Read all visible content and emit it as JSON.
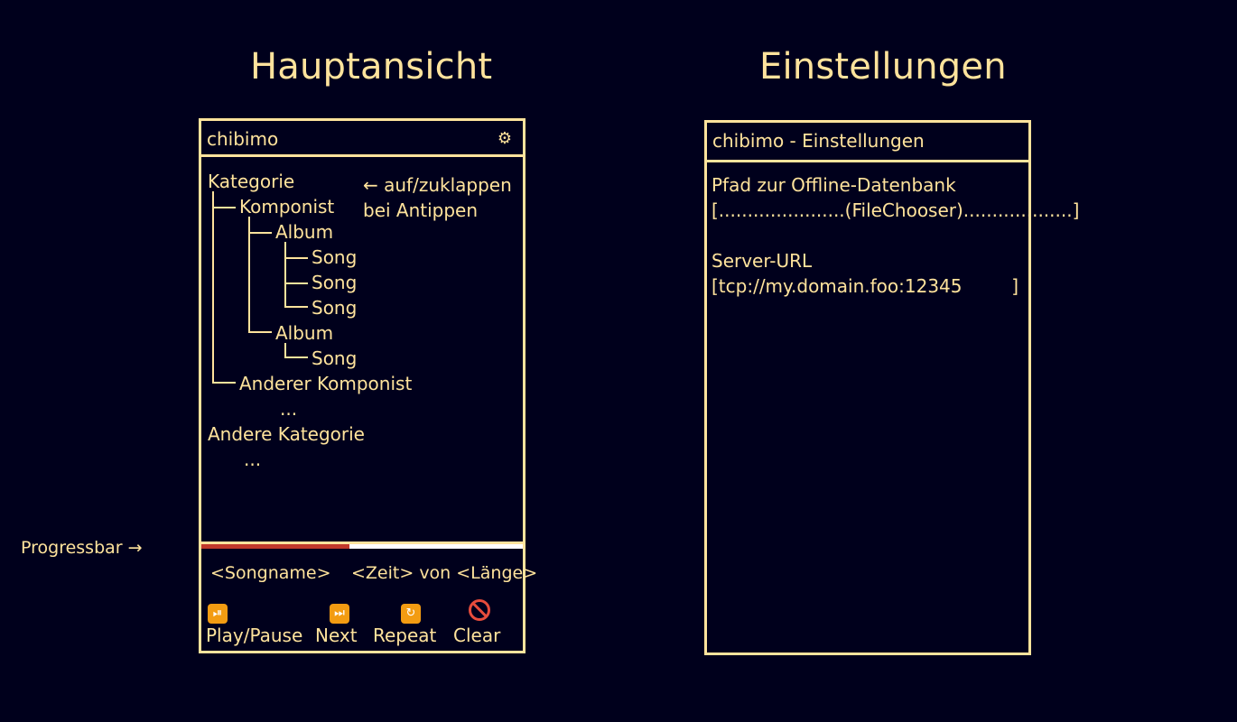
{
  "headings": {
    "main": "Hauptansicht",
    "settings": "Einstellungen"
  },
  "side_label": "Progressbar →",
  "main_view": {
    "title": "chibimo",
    "gear_icon": "gear-icon",
    "tree": {
      "root": "Kategorie",
      "composer": "Komponist",
      "album1": "Album",
      "song1": "Song",
      "song2": "Song",
      "song3": "Song",
      "album2": "Album",
      "song4": "Song",
      "other_composer": "Anderer Komponist",
      "ellipsis1": "...",
      "other_category": "Andere Kategorie",
      "ellipsis2": "..."
    },
    "note_line1": "← auf/zuklappen",
    "note_line2": "bei Antippen",
    "progress": 0.46,
    "progress_color": "#c0392b",
    "song_name": "<Songname>",
    "time_info": "<Zeit> von <Länge>",
    "controls": {
      "play_pause": "Play/Pause",
      "next": "Next",
      "repeat": "Repeat",
      "clear": "Clear"
    },
    "control_icons": [
      "play-pause-icon",
      "next-track-icon",
      "repeat-icon",
      "prohibited-icon"
    ]
  },
  "settings_view": {
    "title": "chibimo - Einstellungen",
    "db_path_label": "Pfad zur Offline-Datenbank",
    "db_path_value": "[......................(FileChooser)...................]",
    "server_url_label": "Server-URL",
    "server_url_value": "[tcp://my.domain.foo:12345",
    "server_url_end": "]"
  },
  "colors": {
    "background": "#00001c",
    "foreground": "#ffe39c"
  }
}
